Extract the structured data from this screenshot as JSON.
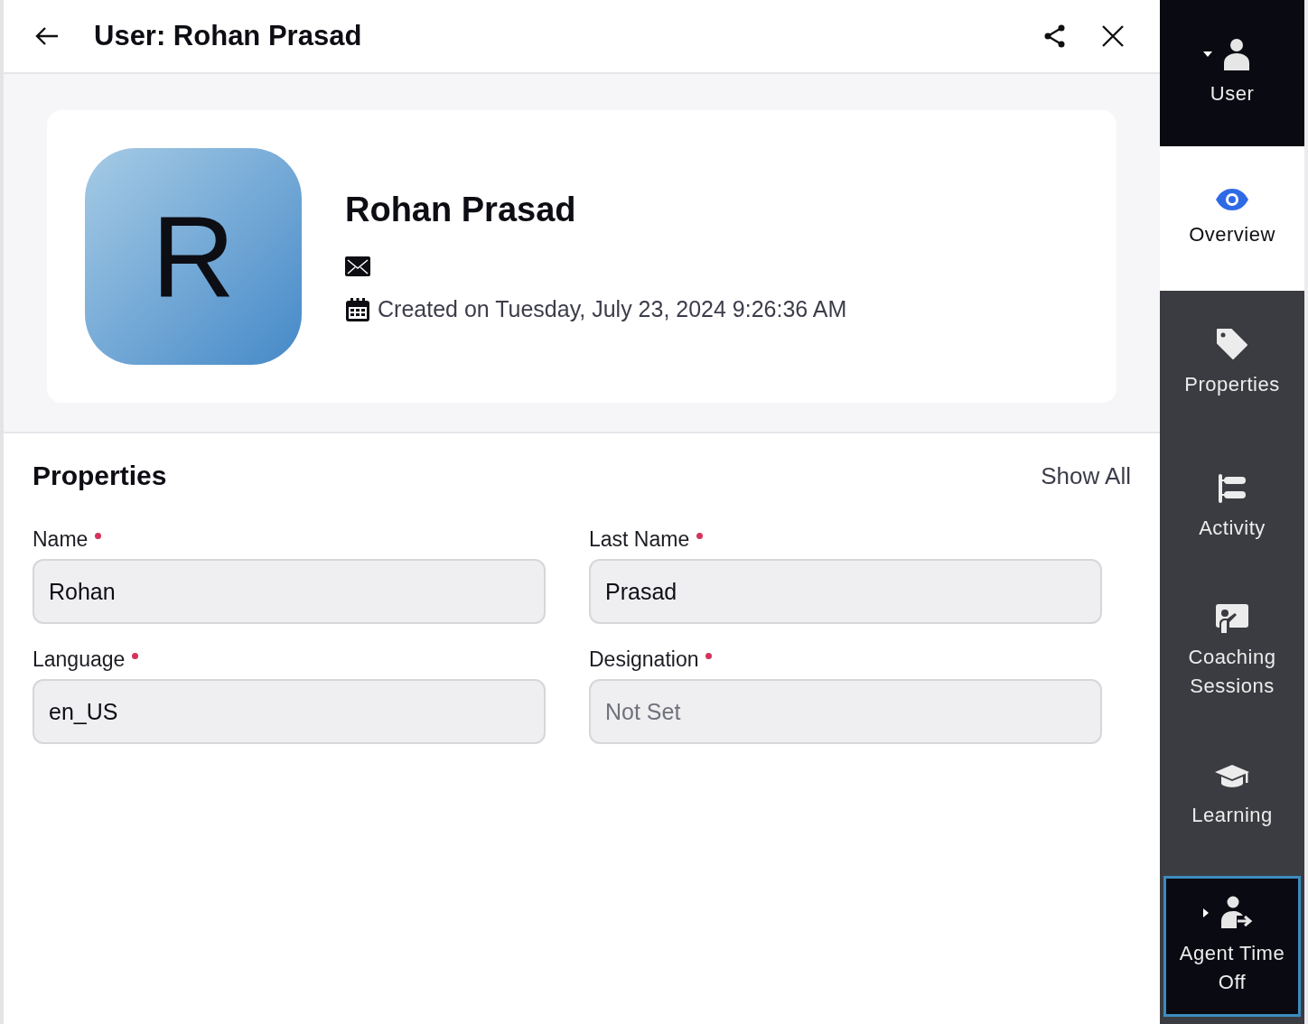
{
  "header": {
    "title": "User: Rohan Prasad"
  },
  "profile": {
    "initial": "R",
    "name": "Rohan Prasad",
    "created": "Created on Tuesday, July 23, 2024 9:26:36 AM"
  },
  "properties": {
    "title": "Properties",
    "show_all": "Show All",
    "fields": [
      {
        "label": "Name",
        "required": true,
        "value": "Rohan"
      },
      {
        "label": "Last Name",
        "required": true,
        "value": "Prasad"
      },
      {
        "label": "Language",
        "required": true,
        "value": "en_US"
      },
      {
        "label": "Designation",
        "required": true,
        "placeholder": "Not Set"
      }
    ]
  },
  "sidebar": {
    "items": [
      {
        "kind": "group",
        "label": "User",
        "expanded": true,
        "selected": false
      },
      {
        "kind": "tab",
        "label": "Overview",
        "selected": true
      },
      {
        "kind": "tab",
        "label": "Properties",
        "selected": false
      },
      {
        "kind": "tab",
        "label": "Activity",
        "selected": false
      },
      {
        "kind": "tab",
        "label": "Coaching Sessions",
        "selected": false
      },
      {
        "kind": "tab",
        "label": "Learning",
        "selected": false
      },
      {
        "kind": "group",
        "label": "Agent Time Off",
        "expanded": false,
        "selected": true
      }
    ]
  }
}
